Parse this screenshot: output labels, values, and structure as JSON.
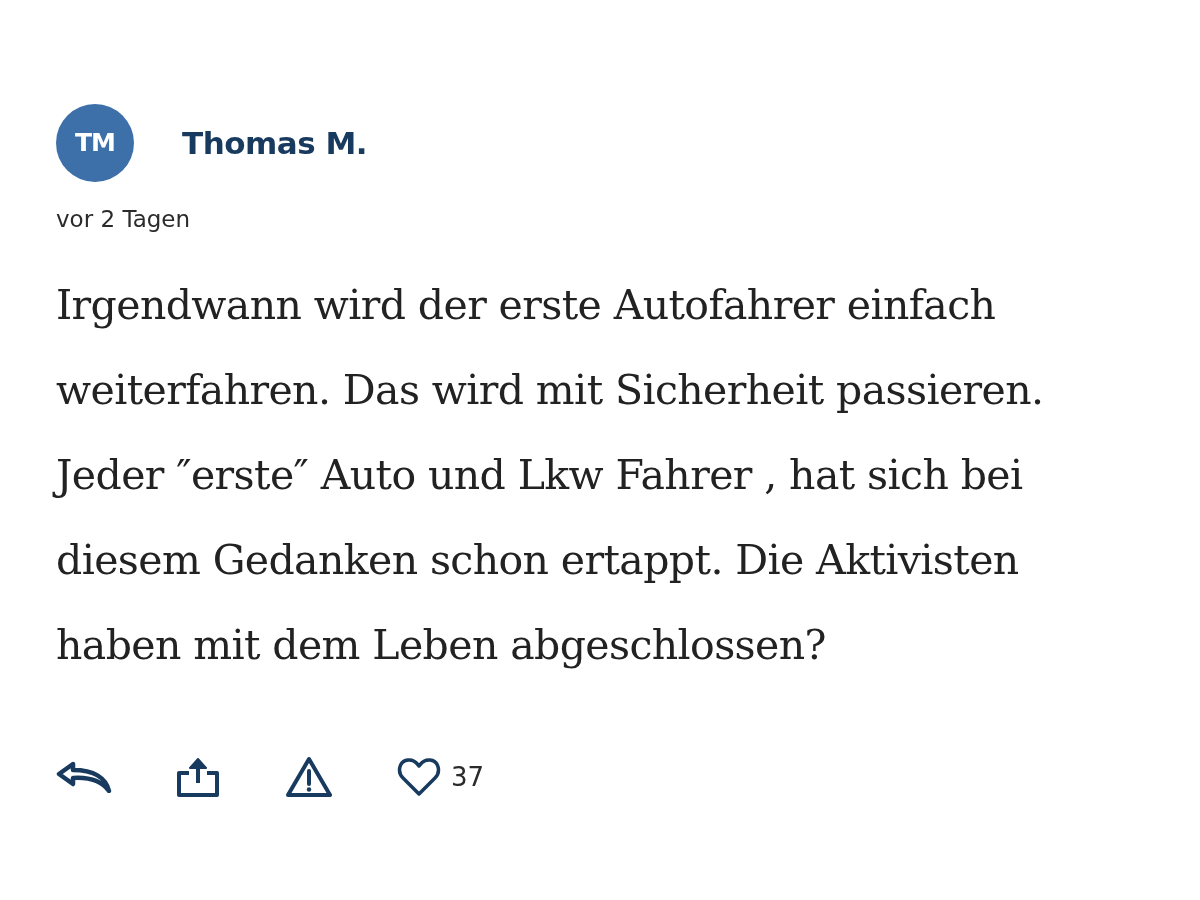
{
  "comment": {
    "author": {
      "initials": "TM",
      "name": "Thomas M."
    },
    "time": "vor 2 Tagen",
    "text": "Irgendwann wird der erste Autofahrer einfach weiterfahren. Das wird mit Sicherheit passieren. Jeder ″erste″ Auto und Lkw Fahrer , hat sich bei diesem Gedanken schon ertappt. Die Aktivisten haben mit dem Leben abgeschlossen?",
    "actions": [
      {
        "kind": "reply"
      },
      {
        "kind": "share"
      },
      {
        "kind": "report"
      },
      {
        "kind": "like",
        "liked": false,
        "count": "37"
      }
    ]
  }
}
